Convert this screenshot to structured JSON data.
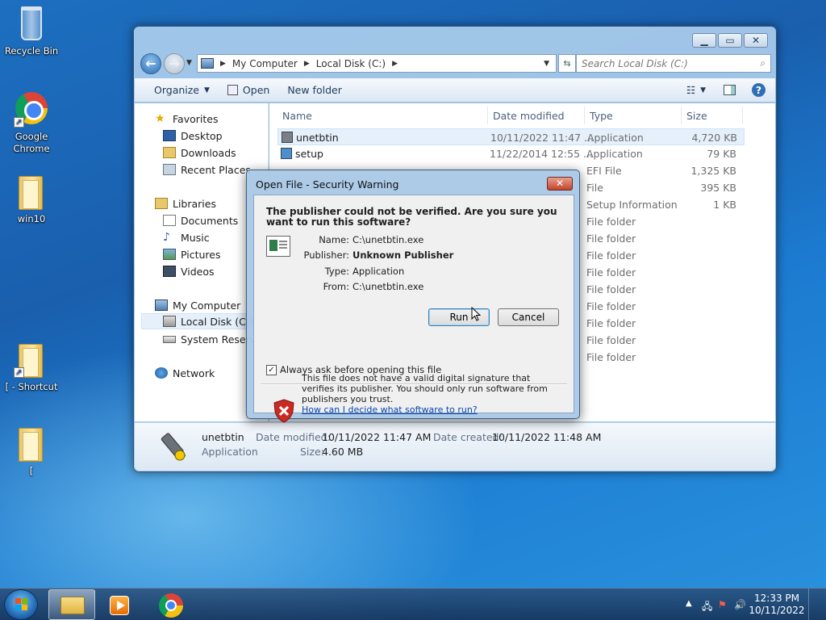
{
  "desktop": {
    "icons": [
      {
        "label": "Recycle Bin"
      },
      {
        "label": "Google Chrome"
      },
      {
        "label": "win10"
      },
      {
        "label": "[ - Shortcut"
      },
      {
        "label": "["
      }
    ]
  },
  "explorer": {
    "breadcrumb": [
      "My Computer",
      "Local Disk (C:)"
    ],
    "search_placeholder": "Search Local Disk (C:)",
    "toolbar": {
      "organize": "Organize",
      "open": "Open",
      "new_folder": "New folder"
    },
    "nav": {
      "favorites": "Favorites",
      "desktop": "Desktop",
      "downloads": "Downloads",
      "recent_places": "Recent Places",
      "libraries": "Libraries",
      "documents": "Documents",
      "music": "Music",
      "pictures": "Pictures",
      "videos": "Videos",
      "my_computer": "My Computer",
      "local_disk": "Local Disk (C:)",
      "system_reserved": "System Reserve",
      "network": "Network"
    },
    "columns": {
      "name": "Name",
      "date": "Date modified",
      "type": "Type",
      "size": "Size"
    },
    "files": [
      {
        "name": "unetbtin",
        "date": "10/11/2022 11:47 ...",
        "type": "Application",
        "size": "4,720 KB"
      },
      {
        "name": "setup",
        "date": "11/22/2014 12:55 ...",
        "type": "Application",
        "size": "79 KB"
      },
      {
        "name": "",
        "date": "",
        "type": "EFI File",
        "size": "1,325 KB"
      },
      {
        "name": "",
        "date": "",
        "type": "File",
        "size": "395 KB"
      },
      {
        "name": "",
        "date": "",
        "type": "Setup Information",
        "size": "1 KB"
      },
      {
        "name": "",
        "date": "",
        "type": "File folder",
        "size": ""
      },
      {
        "name": "",
        "date": "",
        "type": "File folder",
        "size": ""
      },
      {
        "name": "",
        "date": "",
        "type": "File folder",
        "size": ""
      },
      {
        "name": "",
        "date": "",
        "type": "File folder",
        "size": ""
      },
      {
        "name": "",
        "date": "",
        "type": "File folder",
        "size": ""
      },
      {
        "name": "",
        "date": "",
        "type": "File folder",
        "size": ""
      },
      {
        "name": "",
        "date": "",
        "type": "File folder",
        "size": ""
      },
      {
        "name": "",
        "date": "",
        "type": "File folder",
        "size": ""
      },
      {
        "name": "",
        "date": "",
        "type": "File folder",
        "size": ""
      }
    ],
    "details": {
      "name": "unetbtin",
      "type": "Application",
      "date_modified_label": "Date modified:",
      "date_modified": "10/11/2022 11:47 AM",
      "date_created_label": "Date created:",
      "date_created": "10/11/2022 11:48 AM",
      "size_label": "Size:",
      "size": "4.60 MB"
    }
  },
  "dialog": {
    "title": "Open File - Security Warning",
    "question": "The publisher could not be verified.  Are you sure you want to run this software?",
    "name_label": "Name:",
    "name": "C:\\unetbtin.exe",
    "publisher_label": "Publisher:",
    "publisher": "Unknown Publisher",
    "type_label": "Type:",
    "type": "Application",
    "from_label": "From:",
    "from": "C:\\unetbtin.exe",
    "run": "Run",
    "cancel": "Cancel",
    "checkbox": "Always ask before opening this file",
    "warning": "This file does not have a valid digital signature that verifies its publisher.  You should only run software from publishers you trust.",
    "link": "How can I decide what software to run?"
  },
  "taskbar": {
    "time": "12:33 PM",
    "date": "10/11/2022"
  },
  "colors": {
    "accent": "#1c6fc0",
    "danger": "#c3432c",
    "link": "#0645ad"
  }
}
